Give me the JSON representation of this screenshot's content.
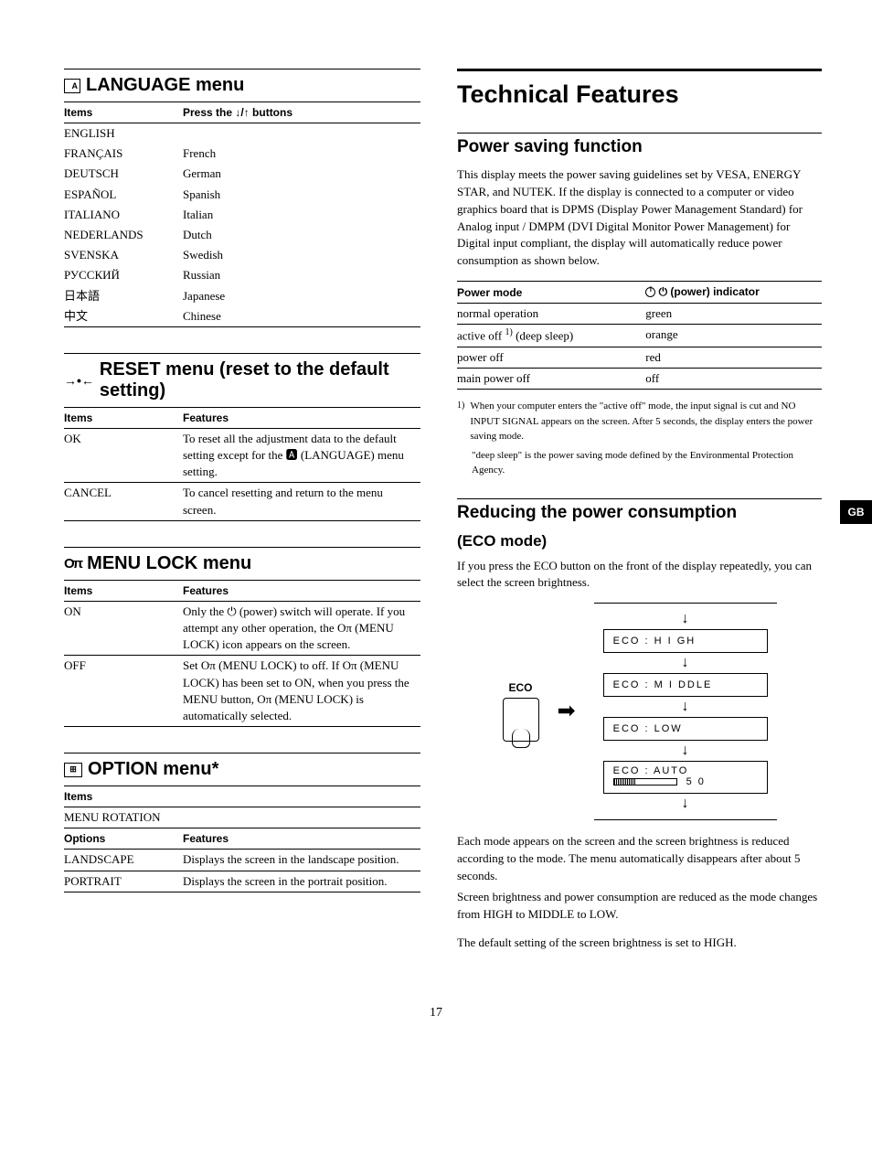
{
  "left": {
    "language": {
      "title": "LANGUAGE menu",
      "header_items": "Items",
      "header_action": "Press the ↓/↑ buttons",
      "rows": [
        {
          "name": "ENGLISH",
          "value": ""
        },
        {
          "name": "FRANÇAIS",
          "value": "French"
        },
        {
          "name": "DEUTSCH",
          "value": "German"
        },
        {
          "name": "ESPAÑOL",
          "value": "Spanish"
        },
        {
          "name": "ITALIANO",
          "value": "Italian"
        },
        {
          "name": "NEDERLANDS",
          "value": "Dutch"
        },
        {
          "name": "SVENSKA",
          "value": "Swedish"
        },
        {
          "name": "РУССКИЙ",
          "value": "Russian"
        },
        {
          "name": "日本語",
          "value": "Japanese"
        },
        {
          "name": "中文",
          "value": "Chinese"
        }
      ]
    },
    "reset": {
      "title": "RESET menu (reset to the default setting)",
      "header_items": "Items",
      "header_features": "Features",
      "rows": [
        {
          "name": "OK",
          "value": "To reset all the adjustment data to the default setting except for the 🅰 (LANGUAGE) menu setting."
        },
        {
          "name": "CANCEL",
          "value": "To cancel resetting and return to the menu screen."
        }
      ]
    },
    "menulock": {
      "title": "MENU LOCK menu",
      "header_items": "Items",
      "header_features": "Features",
      "rows": [
        {
          "name": "ON",
          "value": "Only the ⏻ (power) switch will operate. If you attempt any other operation, the Oπ (MENU LOCK) icon appears on the screen."
        },
        {
          "name": "OFF",
          "value": "Set Oπ (MENU LOCK) to off. If Oπ (MENU LOCK) has been set to ON, when you press the MENU button, Oπ (MENU LOCK) is automatically selected."
        }
      ]
    },
    "option": {
      "title": "OPTION menu*",
      "header_items": "Items",
      "subitem": "MENU ROTATION",
      "header_options": "Options",
      "header_features": "Features",
      "rows": [
        {
          "name": "LANDSCAPE",
          "value": "Displays the screen in the landscape position."
        },
        {
          "name": "PORTRAIT",
          "value": "Displays the screen in the portrait position."
        }
      ]
    }
  },
  "right": {
    "main_title": "Technical Features",
    "powersaving": {
      "title": "Power saving function",
      "body": "This display meets the power saving guidelines set by VESA, ENERGY STAR, and NUTEK. If the display is connected to a computer or video graphics board that is DPMS (Display Power Management Standard) for Analog input / DMPM (DVI Digital Monitor Power Management) for Digital input compliant, the display will automatically reduce power consumption as shown below.",
      "header_mode": "Power mode",
      "header_indicator": "⏻ (power) indicator",
      "rows": [
        {
          "mode": "normal operation",
          "indicator": "green"
        },
        {
          "mode": "active off 1) (deep sleep)",
          "indicator": "orange"
        },
        {
          "mode": "power off",
          "indicator": "red"
        },
        {
          "mode": "main power off",
          "indicator": "off"
        }
      ],
      "footnote_marker": "1)",
      "footnote1": "When your computer enters the \"active off\" mode, the input signal is cut and NO INPUT SIGNAL appears on the screen. After 5 seconds, the display enters the power saving mode.",
      "footnote2": "\"deep sleep\" is the power saving mode defined by the Environmental Protection Agency."
    },
    "eco": {
      "title": "Reducing the power consumption",
      "subtitle": "(ECO mode)",
      "body1": "If you press the ECO button on the front of the display repeatedly, you can select the screen brightness.",
      "button_label": "ECO",
      "modes": [
        "ECO : H I GH",
        "ECO : M I DDLE",
        "ECO : LOW",
        "ECO : AUTO"
      ],
      "auto_value": "5 0",
      "body2": "Each mode appears on the screen and the screen brightness is reduced according to the mode. The menu automatically disappears after about 5 seconds.",
      "body3": "Screen brightness and power consumption are reduced as the mode changes from HIGH to MIDDLE to LOW.",
      "body4": "The default setting of the screen brightness is set to HIGH."
    },
    "tab": "GB"
  },
  "page_number": "17"
}
